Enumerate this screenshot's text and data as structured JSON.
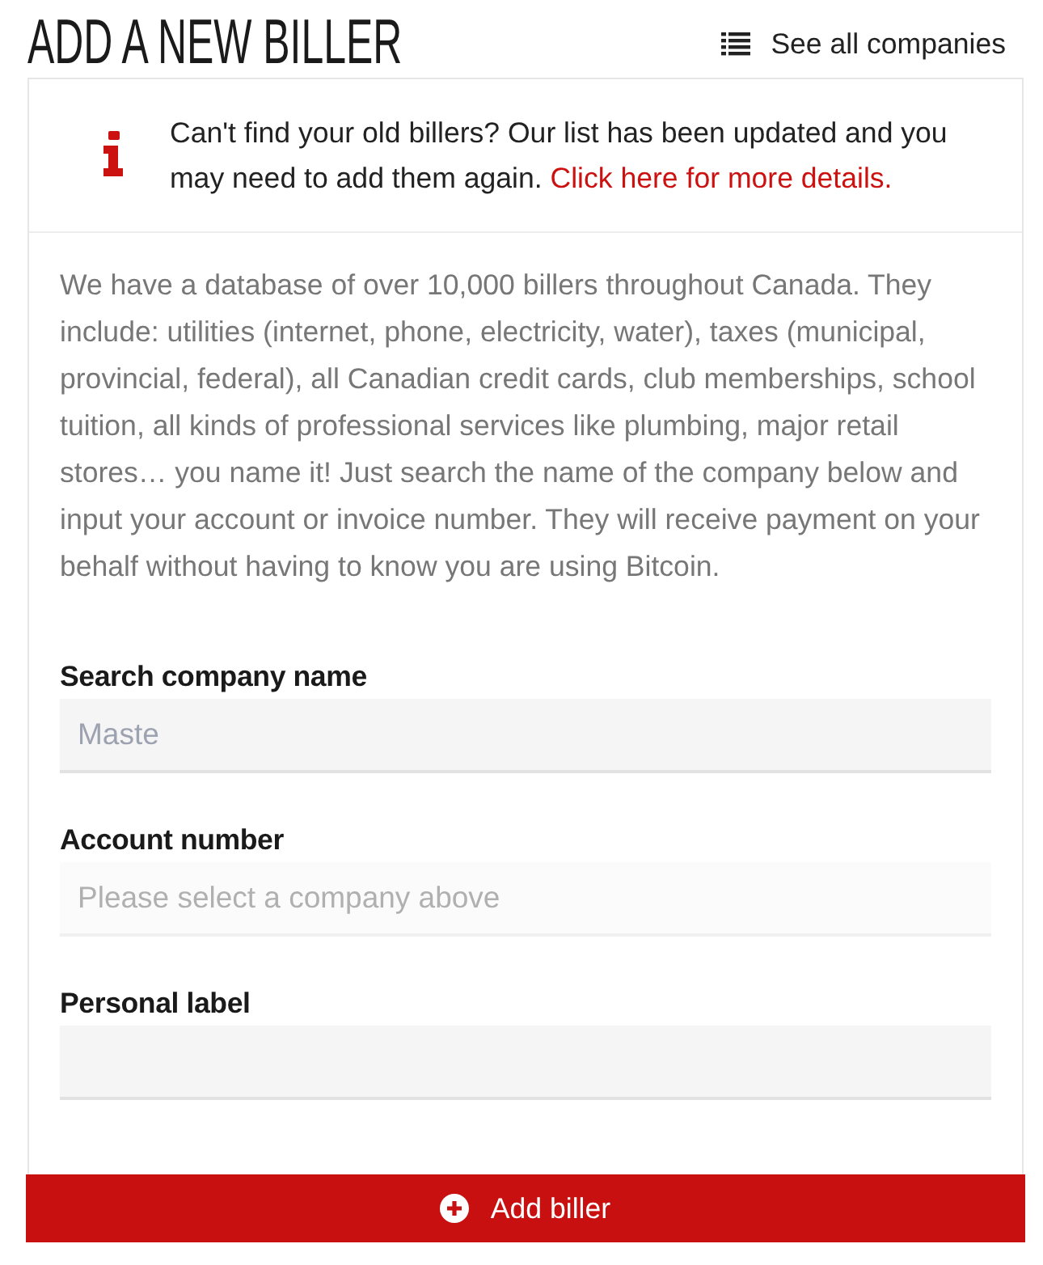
{
  "header": {
    "title": "ADD A NEW BILLER",
    "see_all_link": "See all companies"
  },
  "notice": {
    "text": "Can't find your old billers? Our list has been updated and you may need to add them again.",
    "link": "Click here for more details."
  },
  "description": "We have a database of over 10,000 billers throughout Canada. They include: utilities (internet, phone, electricity, water), taxes (municipal, provincial, federal), all Canadian credit cards, club memberships, school tuition, all kinds of professional services like plumbing, major retail stores… you name it! Just search the name of the company below and input your account or invoice number. They will receive payment on your behalf without having to know you are using Bitcoin.",
  "fields": [
    {
      "label": "Search company name",
      "value": "Maste",
      "disabled": false
    },
    {
      "label": "Account number",
      "placeholder": "Please select a company above",
      "disabled": true
    },
    {
      "label": "Personal label",
      "disabled": false
    }
  ],
  "submit_button": {
    "label": "Add biller"
  }
}
